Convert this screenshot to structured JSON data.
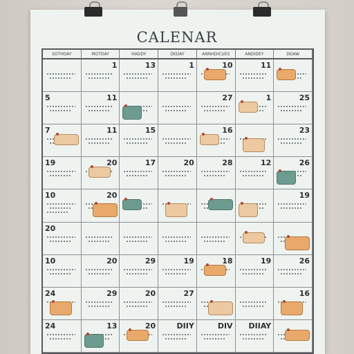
{
  "title": "CALENAR",
  "weekdays": [
    "SOTHDAY",
    "MOTDAY",
    "HADDY",
    "DEDAY",
    "ANNHDICUES",
    "ANDIDEY",
    "DDAW"
  ],
  "rows": [
    [
      {
        "num": "",
        "lines": 2
      },
      {
        "num": "1",
        "lines": 2
      },
      {
        "num": "13",
        "lines": 2
      },
      {
        "num": "1",
        "lines": 2
      },
      {
        "num": "10",
        "lines": 2,
        "note": {
          "color": "orange",
          "text": ""
        }
      },
      {
        "num": "11",
        "lines": 2
      },
      {
        "num": "",
        "lines": 2,
        "note": {
          "color": "orange",
          "text": ""
        }
      }
    ],
    [
      {
        "num": "5",
        "lines": 2
      },
      {
        "num": "11",
        "lines": 2
      },
      {
        "num": "",
        "lines": 2,
        "note": {
          "color": "teal",
          "text": ""
        }
      },
      {
        "num": "",
        "lines": 2
      },
      {
        "num": "27",
        "lines": 2
      },
      {
        "num": "1",
        "lines": 2,
        "note": {
          "color": "tan",
          "text": ""
        }
      },
      {
        "num": "25",
        "lines": 2
      }
    ],
    [
      {
        "num": "7",
        "lines": 2,
        "note": {
          "color": "tan",
          "text": ""
        }
      },
      {
        "num": "11",
        "lines": 2
      },
      {
        "num": "15",
        "lines": 2
      },
      {
        "num": "",
        "lines": 2
      },
      {
        "num": "16",
        "lines": 2,
        "note": {
          "color": "tan",
          "text": ""
        }
      },
      {
        "num": "",
        "lines": 2,
        "note": {
          "color": "tan",
          "text": ""
        }
      },
      {
        "num": "23",
        "lines": 2
      }
    ],
    [
      {
        "num": "19",
        "lines": 2
      },
      {
        "num": "20",
        "lines": 2,
        "note": {
          "color": "tan",
          "text": ""
        }
      },
      {
        "num": "17",
        "lines": 2
      },
      {
        "num": "20",
        "lines": 2
      },
      {
        "num": "28",
        "lines": 2
      },
      {
        "num": "12",
        "lines": 2
      },
      {
        "num": "26",
        "lines": 2,
        "note": {
          "color": "teal",
          "text": ""
        }
      }
    ],
    [
      {
        "num": "10",
        "lines": 3
      },
      {
        "num": "20",
        "lines": 2,
        "note": {
          "color": "orange",
          "text": ""
        }
      },
      {
        "num": "",
        "lines": 2,
        "note": {
          "color": "teal",
          "text": ""
        }
      },
      {
        "num": "",
        "lines": 2,
        "note": {
          "color": "tan",
          "text": ""
        }
      },
      {
        "num": "",
        "lines": 2,
        "note": {
          "color": "teal",
          "text": ""
        }
      },
      {
        "num": "",
        "lines": 2,
        "note": {
          "color": "tan",
          "text": ""
        }
      },
      {
        "num": "19",
        "lines": 2
      }
    ],
    [
      {
        "num": "20",
        "lines": 2
      },
      {
        "num": "",
        "lines": 2
      },
      {
        "num": "",
        "lines": 2
      },
      {
        "num": "",
        "lines": 2
      },
      {
        "num": "",
        "lines": 2
      },
      {
        "num": "",
        "lines": 2,
        "note": {
          "color": "tan",
          "text": ""
        }
      },
      {
        "num": "",
        "lines": 2,
        "note": {
          "color": "orange",
          "text": ""
        }
      }
    ],
    [
      {
        "num": "10",
        "lines": 2
      },
      {
        "num": "20",
        "lines": 2
      },
      {
        "num": "29",
        "lines": 2
      },
      {
        "num": "19",
        "lines": 2
      },
      {
        "num": "18",
        "lines": 2,
        "note": {
          "color": "orange",
          "text": ""
        }
      },
      {
        "num": "19",
        "lines": 2
      },
      {
        "num": "26",
        "lines": 2
      }
    ],
    [
      {
        "num": "24",
        "lines": 2,
        "note": {
          "color": "orange",
          "text": ""
        }
      },
      {
        "num": "29",
        "lines": 2
      },
      {
        "num": "20",
        "lines": 2
      },
      {
        "num": "27",
        "lines": 2
      },
      {
        "num": "",
        "lines": 2,
        "note": {
          "color": "tan",
          "text": ""
        }
      },
      {
        "num": "",
        "lines": 2
      },
      {
        "num": "16",
        "lines": 2,
        "note": {
          "color": "orange",
          "text": ""
        }
      }
    ],
    [
      {
        "num": "24",
        "lines": 2
      },
      {
        "num": "13",
        "lines": 2,
        "note": {
          "color": "teal",
          "text": ""
        }
      },
      {
        "num": "20",
        "lines": 2,
        "note": {
          "color": "orange",
          "text": ""
        }
      },
      {
        "num": "DIIY",
        "lines": 2
      },
      {
        "num": "DIV",
        "lines": 2
      },
      {
        "num": "DIIAY",
        "lines": 2
      },
      {
        "num": "",
        "lines": 2,
        "note": {
          "color": "orange",
          "text": ""
        }
      }
    ]
  ]
}
